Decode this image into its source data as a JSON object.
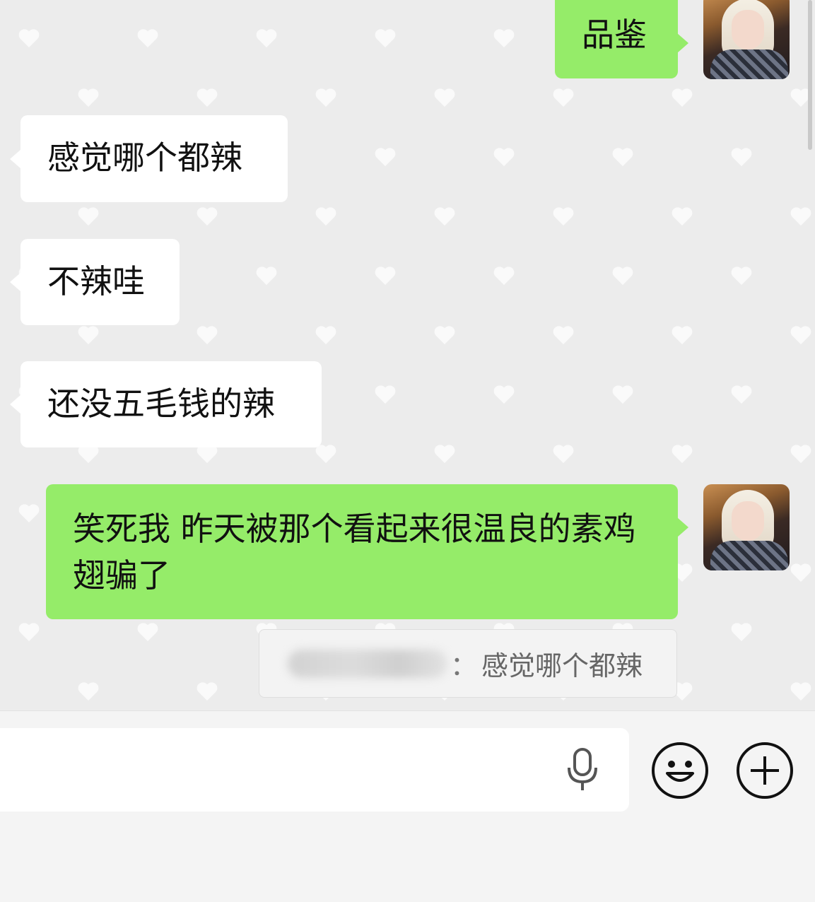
{
  "messages": [
    {
      "side": "right",
      "text": "品鉴"
    },
    {
      "side": "left",
      "text": "感觉哪个都辣"
    },
    {
      "side": "left",
      "text": "不辣哇"
    },
    {
      "side": "left",
      "text": "还没五毛钱的辣"
    },
    {
      "side": "right",
      "text": "笑死我 昨天被那个看起来很温良的素鸡翅骗了"
    }
  ],
  "quote": {
    "sender_separator": "：",
    "text": "感觉哪个都辣"
  },
  "input": {
    "value": "",
    "voice_icon": "microphone-icon",
    "emoji_icon": "smiley-icon",
    "more_icon": "plus-icon"
  },
  "colors": {
    "sent_bubble": "#95ec69",
    "received_bubble": "#ffffff",
    "background": "#ececec"
  }
}
